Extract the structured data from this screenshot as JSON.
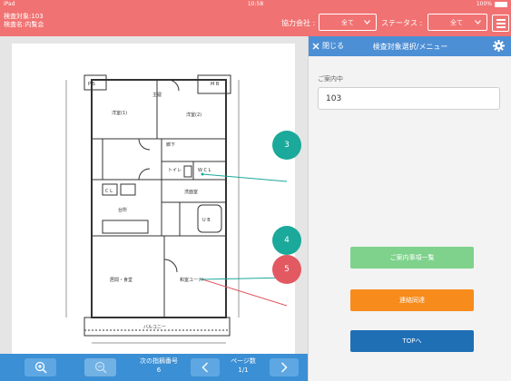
{
  "status_bar": {
    "device": "iPad",
    "time": "10:58",
    "battery": "100%"
  },
  "header": {
    "target_line": "検査対象:103",
    "name_line": "検査名:内覧会",
    "partner_label": "協力会社 :",
    "partner_value": "全て",
    "status_label": "ステータス :",
    "status_value": "全て"
  },
  "markers": [
    {
      "number": "3",
      "color": "teal"
    },
    {
      "number": "4",
      "color": "teal"
    },
    {
      "number": "5",
      "color": "red"
    }
  ],
  "floor_plan": {
    "rooms": {
      "bedroom1": "洋室(1)",
      "bedroom2": "洋室(2)",
      "storage": "主寝",
      "hall": "廊下",
      "toilet": "トイレ",
      "wcl": "W C L",
      "kitchen": "台所",
      "washroom": "洗面室",
      "bath": "U B",
      "living": "居間・食堂",
      "japanese": "和室ユーナ",
      "balcony": "バルコニー",
      "cl": "C L",
      "mb": "M B",
      "ps": "P S"
    }
  },
  "toolbar": {
    "next_label": "次の指摘番号",
    "next_value": "6",
    "page_label": "ページ数",
    "page_value": "1/1"
  },
  "panel": {
    "close_label": "閉じる",
    "title": "検査対象選択/メニュー",
    "guide_label": "ご案内中",
    "guide_value": "103",
    "btn_guidance": "ご案内事項一覧",
    "btn_contact": "連絡同達",
    "btn_top": "TOPへ"
  },
  "colors": {
    "header": "#f17272",
    "toolbar": "#3b8fd4",
    "panel_header": "#4d8fd5",
    "teal_marker": "#1aa99a",
    "red_marker": "#e25962",
    "green_button": "#7ed28c",
    "orange_button": "#f78b1c",
    "blue_button": "#1f6fb5"
  }
}
